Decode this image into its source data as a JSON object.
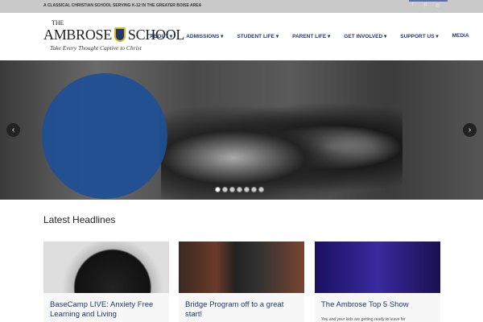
{
  "topbar": {
    "tagline": "A CLASSICAL CHRISTIAN SCHOOL SERVING K-12 IN THE GREATER BOISE AREA",
    "social": [
      "f",
      "p",
      "◎"
    ]
  },
  "logo": {
    "the": "THE",
    "name_left": "AMBROSE",
    "name_right": "SCHOOL",
    "motto": "Take Every Thought Captive to Christ"
  },
  "nav": [
    "ABOUT ▾",
    "ADMISSIONS ▾",
    "STUDENT LIFE ▾",
    "PARENT LIFE ▾",
    "GET INVOLVED ▾",
    "SUPPORT US ▾",
    "MEDIA"
  ],
  "slider": {
    "prev": "‹",
    "next": "›",
    "slide_count": 7,
    "active_slide": 1,
    "accent": "#1d4f95"
  },
  "headlines": {
    "title": "Latest Headlines",
    "cards": [
      {
        "title": "BaseCamp LIVE: Anxiety Free Learning and Living",
        "excerpt": ""
      },
      {
        "title": "Bridge Program off to a great start!",
        "excerpt": ""
      },
      {
        "title": "The Ambrose Top 5 Show",
        "excerpt": "You and your kids are getting ready to leave for"
      }
    ]
  }
}
